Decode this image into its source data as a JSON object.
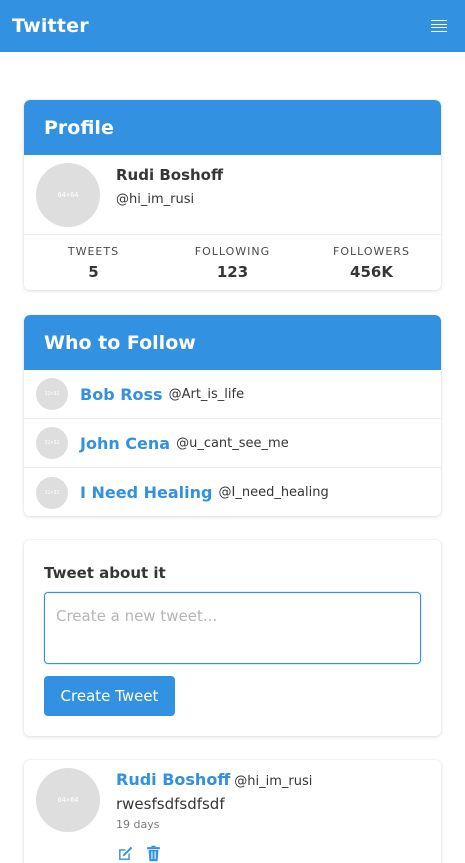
{
  "navbar": {
    "brand": "Twitter",
    "menu_icon": "hamburger-icon"
  },
  "profile": {
    "title": "Profile",
    "avatar_placeholder": "64×64",
    "name": "Rudi Boshoff",
    "handle": "@hi_im_rusi",
    "stats": [
      {
        "label": "TWEETS",
        "value": "5"
      },
      {
        "label": "FOLLOWING",
        "value": "123"
      },
      {
        "label": "FOLLOWERS",
        "value": "456K"
      }
    ]
  },
  "who_to_follow": {
    "title": "Who to Follow",
    "avatar_placeholder": "32×32",
    "users": [
      {
        "name": "Bob Ross",
        "handle": "@Art_is_life"
      },
      {
        "name": "John Cena",
        "handle": "@u_cant_see_me"
      },
      {
        "name": "I Need Healing",
        "handle": "@I_need_healing"
      }
    ]
  },
  "tweet_form": {
    "label": "Tweet about it",
    "placeholder": "Create a new tweet...",
    "value": "",
    "button_label": "Create Tweet"
  },
  "tweets": [
    {
      "avatar_placeholder": "64×64",
      "author": "Rudi Boshoff",
      "handle": "@hi_im_rusi",
      "text": "rwesfsdfsdfsdf",
      "time": "19 days",
      "edit_icon": "edit-icon",
      "delete_icon": "trash-icon"
    }
  ],
  "colors": {
    "primary": "#3291e0",
    "text": "#363636",
    "muted": "#7a7a7a",
    "placeholder_avatar": "#dedede"
  }
}
